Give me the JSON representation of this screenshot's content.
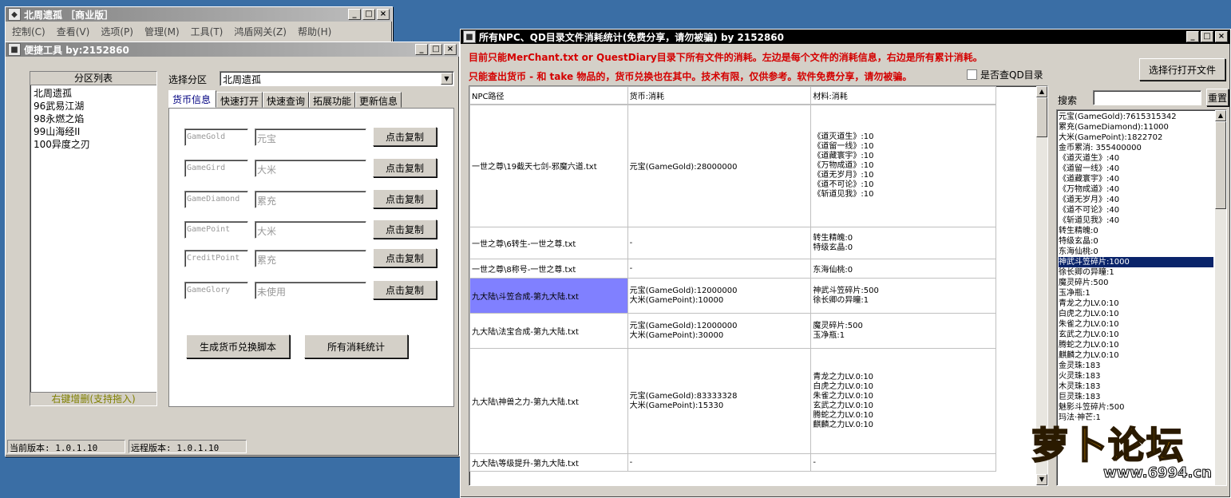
{
  "main_window": {
    "title": "北周遗孤 ［商业版］",
    "menu": [
      "控制(C)",
      "查看(V)",
      "选项(P)",
      "管理(M)",
      "工具(T)",
      "鸿盾网关(Z)",
      "帮助(H)"
    ]
  },
  "tool_window": {
    "title": "便捷工具   by:2152860",
    "region_list_header": "分区列表",
    "regions": [
      "北周遗孤",
      "96武易江湖",
      "98永燃之焰",
      "99山海经II",
      "100异度之刃"
    ],
    "region_footer": "右键增删(支持拖入)",
    "select_label": "选择分区",
    "select_value": "北周遗孤",
    "tabs": [
      "货币信息",
      "快速打开",
      "快速查询",
      "拓展功能",
      "更新信息"
    ],
    "currency_rows": [
      {
        "code": "GameGold",
        "name": "元宝",
        "button": "点击复制"
      },
      {
        "code": "GameGird",
        "name": "大米",
        "button": "点击复制"
      },
      {
        "code": "GameDiamond",
        "name": "累充",
        "button": "点击复制"
      },
      {
        "code": "GamePoint",
        "name": "大米",
        "button": "点击复制"
      },
      {
        "code": "CreditPoint",
        "name": "累充",
        "button": "点击复制"
      },
      {
        "code": "GameGlory",
        "name": "未使用",
        "button": "点击复制"
      }
    ],
    "generate_button": "生成货币兑换脚本",
    "stats_button": "所有消耗统计",
    "current_version": "当前版本: 1.0.1.10",
    "remote_version": "远程版本: 1.0.1.10"
  },
  "stats_window": {
    "title": "所有NPC、QD目录文件消耗统计(免费分享，请勿被骗)     by 2152860",
    "notice1": "目前只能MerChant.txt or QuestDiary目录下所有文件的消耗。左边是每个文件的消耗信息，右边是所有累计消耗。",
    "notice2": "只能查出货币 - 和 take 物品的，货币兑换也在其中。技术有限，仅供参考。软件免费分享，请勿被骗。",
    "checkbox_label": "是否查QD目录",
    "open_button": "选择行打开文件",
    "search_label": "搜索",
    "reset_button": "重置",
    "columns": [
      "NPC路径",
      "货币:消耗",
      "材料:消耗"
    ],
    "rows": [
      {
        "path": "一世之尊\\19截天七剑-邪魔六道.txt",
        "currency": [
          "元宝(GameGold):28000000"
        ],
        "material": [
          "《道灭道生》:10",
          "《道留一线》:10",
          "《道藏寰宇》:10",
          "《万物成道》:10",
          "《道无岁月》:10",
          "《道不可论》:10",
          "《斩道见我》:10"
        ]
      },
      {
        "path": "一世之尊\\6转生-一世之尊.txt",
        "currency": [
          "-"
        ],
        "material": [
          "转生精魄:0",
          "特级玄晶:0"
        ]
      },
      {
        "path": "一世之尊\\8称号-一世之尊.txt",
        "currency": [
          "-"
        ],
        "material": [
          "东海仙桃:0"
        ]
      },
      {
        "path": "九大陆\\斗笠合成-第九大陆.txt",
        "currency": [
          "元宝(GameGold):12000000",
          "大米(GamePoint):10000"
        ],
        "material": [
          "神武斗笠碎片:500",
          "徐长卿の异瞳:1"
        ]
      },
      {
        "path": "九大陆\\法宝合成-第九大陆.txt",
        "currency": [
          "元宝(GameGold):12000000",
          "大米(GamePoint):30000"
        ],
        "material": [
          "魔灵碎片:500",
          "玉净瓶:1"
        ]
      },
      {
        "path": "九大陆\\神兽之力-第九大陆.txt",
        "currency": [
          "元宝(GameGold):83333328",
          "大米(GamePoint):15330"
        ],
        "material": [
          "青龙之力LV.0:10",
          "白虎之力LV.0:10",
          "朱雀之力LV.0:10",
          "玄武之力LV.0:10",
          "腾蛇之力LV.0:10",
          "麒麟之力LV.0:10"
        ]
      },
      {
        "path": "九大陆\\等级提升-第九大陆.txt",
        "currency": [
          "-"
        ],
        "material": [
          "-"
        ]
      }
    ],
    "totals": [
      "元宝(GameGold):7615315342",
      "累充(GameDiamond):11000",
      "大米(GamePoint):1822702",
      "金币累消: 355400000",
      "《道灭道生》:40",
      "《道留一线》:40",
      "《道藏寰宇》:40",
      "《万物成道》:40",
      "《道无岁月》:40",
      "《道不可论》:40",
      "《斩道见我》:40",
      "转生精魄:0",
      "特级玄晶:0",
      "东海仙桃:0",
      "神武斗笠碎片:1000",
      "徐长卿の异瞳:1",
      "魔灵碎片:500",
      "玉净瓶:1",
      "青龙之力LV.0:10",
      "白虎之力LV.0:10",
      "朱雀之力LV.0:10",
      "玄武之力LV.0:10",
      "腾蛇之力LV.0:10",
      "麒麟之力LV.0:10",
      "金灵珠:183",
      "火灵珠:183",
      "木灵珠:183",
      "巨灵珠:183",
      "魅影斗笠碎片:500",
      "玛法·神芒:1"
    ],
    "totals_highlight_index": 14
  },
  "watermark": {
    "brand": "萝卜论坛",
    "url": "www.6994.cn"
  }
}
